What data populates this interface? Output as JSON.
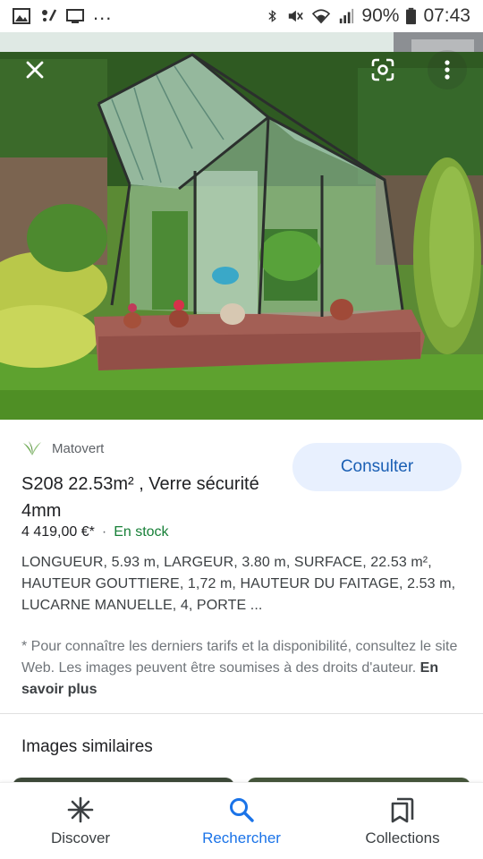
{
  "status_bar": {
    "battery_percent": "90%",
    "time": "07:43",
    "ellipsis": "..."
  },
  "hero": {
    "close_icon": "close-icon",
    "lens_icon": "google-lens-icon",
    "more_icon": "more-vert-icon"
  },
  "product": {
    "merchant": "Matovert",
    "title": "S208 22.53m² , Verre sécurité 4mm",
    "price": "4 419,00 €*",
    "separator": "·",
    "stock": "En stock",
    "description": "LONGUEUR, 5.93 m, LARGEUR, 3.80 m, SURFACE, 22.53 m², HAUTEUR GOUTTIERE, 1,72 m, HAUTEUR DU FAITAGE, 2.53 m, LUCARNE MANUELLE, 4, PORTE ...",
    "disclaimer": "* Pour connaître les derniers tarifs et la disponibilité, consultez le site Web. Les images peuvent être soumises à des droits d'auteur.",
    "learn_more": "En savoir plus",
    "consult_button": "Consulter"
  },
  "similar": {
    "title": "Images similaires"
  },
  "bottom_nav": {
    "items": [
      {
        "label": "Discover",
        "icon": "asterisk-icon"
      },
      {
        "label": "Rechercher",
        "icon": "search-icon"
      },
      {
        "label": "Collections",
        "icon": "collections-icon"
      }
    ],
    "active_index": 1
  },
  "colors": {
    "accent": "#1a73e8",
    "stock_green": "#188038",
    "consult_bg": "#e8f0fe"
  }
}
